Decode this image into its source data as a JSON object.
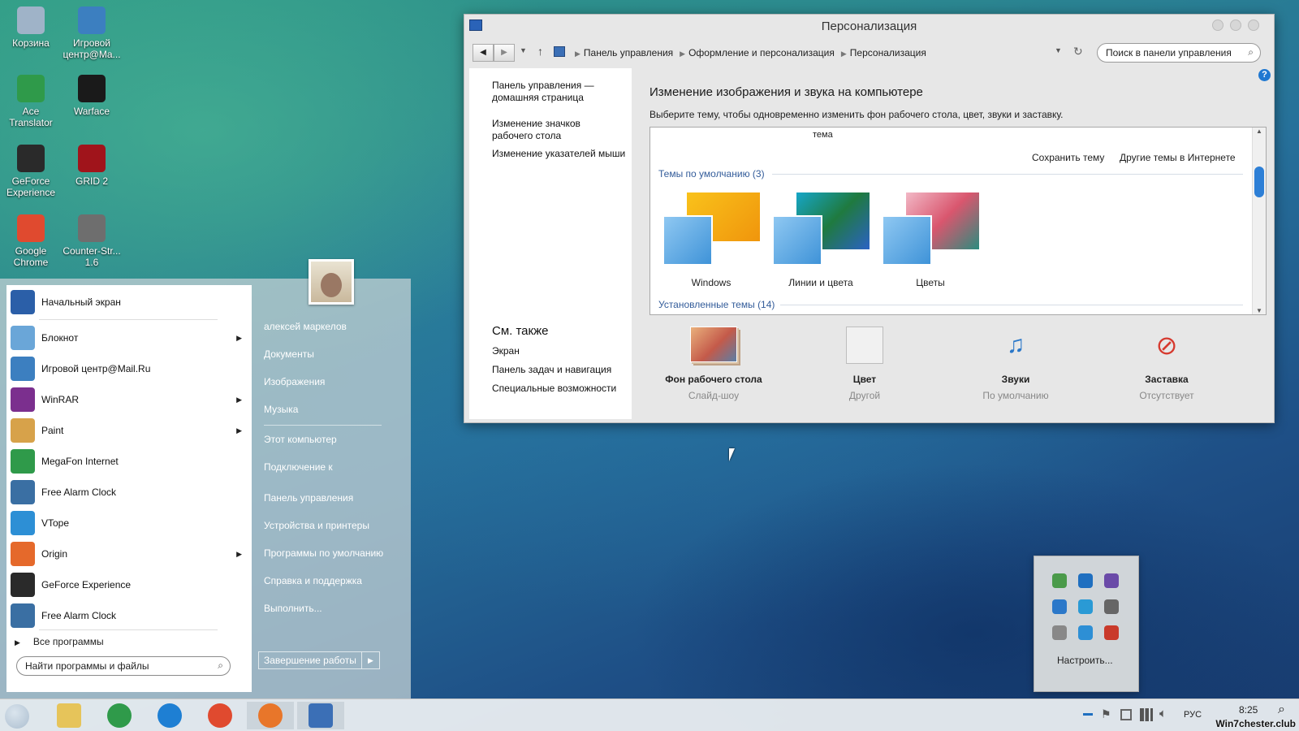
{
  "desktop_icons": [
    {
      "label": "Корзина",
      "icon": "recycle-bin-icon",
      "color": "#9fb3c8"
    },
    {
      "label": "Игровой центр@Ma...",
      "icon": "game-center-icon",
      "color": "#3c7fc0"
    },
    {
      "label": "Ace Translator",
      "icon": "globe-icon",
      "color": "#2f9a4a"
    },
    {
      "label": "Warface",
      "icon": "warface-icon",
      "color": "#1a1a1a"
    },
    {
      "label": "GeForce Experience",
      "icon": "nvidia-icon",
      "color": "#2a2a2a"
    },
    {
      "label": "GRID 2",
      "icon": "grid2-icon",
      "color": "#a0141b"
    },
    {
      "label": "Google Chrome",
      "icon": "chrome-icon",
      "color": "#e04a2f"
    },
    {
      "label": "Counter-Str... 1.6",
      "icon": "counter-strike-icon",
      "color": "#6e6e6e"
    }
  ],
  "window": {
    "title": "Персонализация",
    "breadcrumb": [
      "Панель управления",
      "Оформление и персонализация",
      "Персонализация"
    ],
    "search_placeholder": "Поиск в панели управления",
    "left_links": [
      "Панель управления — домашняя страница",
      "Изменение значков рабочего стола",
      "Изменение указателей мыши"
    ],
    "see_also_title": "См. также",
    "see_also": [
      "Экран",
      "Панель задач и навигация",
      "Специальные возможности"
    ],
    "heading": "Изменение изображения и звука на компьютере",
    "subheading": "Выберите тему, чтобы одновременно изменить фон рабочего стола, цвет, звуки и заставку.",
    "theme_fragment": "тема",
    "save_theme": "Сохранить тему",
    "more_themes": "Другие темы в Интернете",
    "default_group": "Темы по умолчанию (3)",
    "installed_group": "Установленные темы (14)",
    "themes": [
      "Windows",
      "Линии и цвета",
      "Цветы"
    ],
    "bottom": [
      {
        "title": "Фон рабочего стола",
        "sub": "Слайд-шоу"
      },
      {
        "title": "Цвет",
        "sub": "Другой"
      },
      {
        "title": "Звуки",
        "sub": "По умолчанию"
      },
      {
        "title": "Заставка",
        "sub": "Отсутствует"
      }
    ]
  },
  "start_menu": {
    "programs": [
      {
        "label": "Начальный экран",
        "icon": "start-screen-icon",
        "color": "#2b5fa8",
        "arrow": false
      },
      {
        "label": "Блокнот",
        "icon": "notepad-icon",
        "color": "#6aa6d8",
        "arrow": true
      },
      {
        "label": "Игровой центр@Mail.Ru",
        "icon": "game-center-icon",
        "color": "#3c7fc0",
        "arrow": false
      },
      {
        "label": "WinRAR",
        "icon": "winrar-icon",
        "color": "#7b2f8e",
        "arrow": true
      },
      {
        "label": "Paint",
        "icon": "paint-icon",
        "color": "#d7a24a",
        "arrow": true
      },
      {
        "label": "MegaFon Internet",
        "icon": "megafon-icon",
        "color": "#2f9a4a",
        "arrow": false
      },
      {
        "label": "Free Alarm Clock",
        "icon": "alarm-clock-icon",
        "color": "#3a6fa3",
        "arrow": false
      },
      {
        "label": "VTope",
        "icon": "vtope-icon",
        "color": "#2d8fd5",
        "arrow": false
      },
      {
        "label": "Origin",
        "icon": "origin-icon",
        "color": "#e5692b",
        "arrow": true
      },
      {
        "label": "GeForce Experience",
        "icon": "nvidia-icon",
        "color": "#2a2a2a",
        "arrow": false
      },
      {
        "label": "Free Alarm Clock",
        "icon": "alarm-clock-icon",
        "color": "#3a6fa3",
        "arrow": false
      }
    ],
    "all_programs": "Все программы",
    "search_placeholder": "Найти программы и файлы",
    "user_name": "алексей маркелов",
    "right_links": [
      "Документы",
      "Изображения",
      "Музыка",
      "Этот компьютер",
      "Подключение к",
      "Панель управления",
      "Устройства и принтеры",
      "Программы по умолчанию",
      "Справка и поддержка",
      "Выполнить..."
    ],
    "shutdown": "Завершение работы"
  },
  "tray_popup": {
    "customize": "Настроить..."
  },
  "taskbar": {
    "pinned": [
      "file-explorer-icon",
      "globe-icon",
      "internet-explorer-icon",
      "chrome-icon",
      "firefox-icon",
      "control-panel-icon"
    ],
    "language": "РУС",
    "time": "8:25",
    "watermark": "Win7chester.club"
  }
}
